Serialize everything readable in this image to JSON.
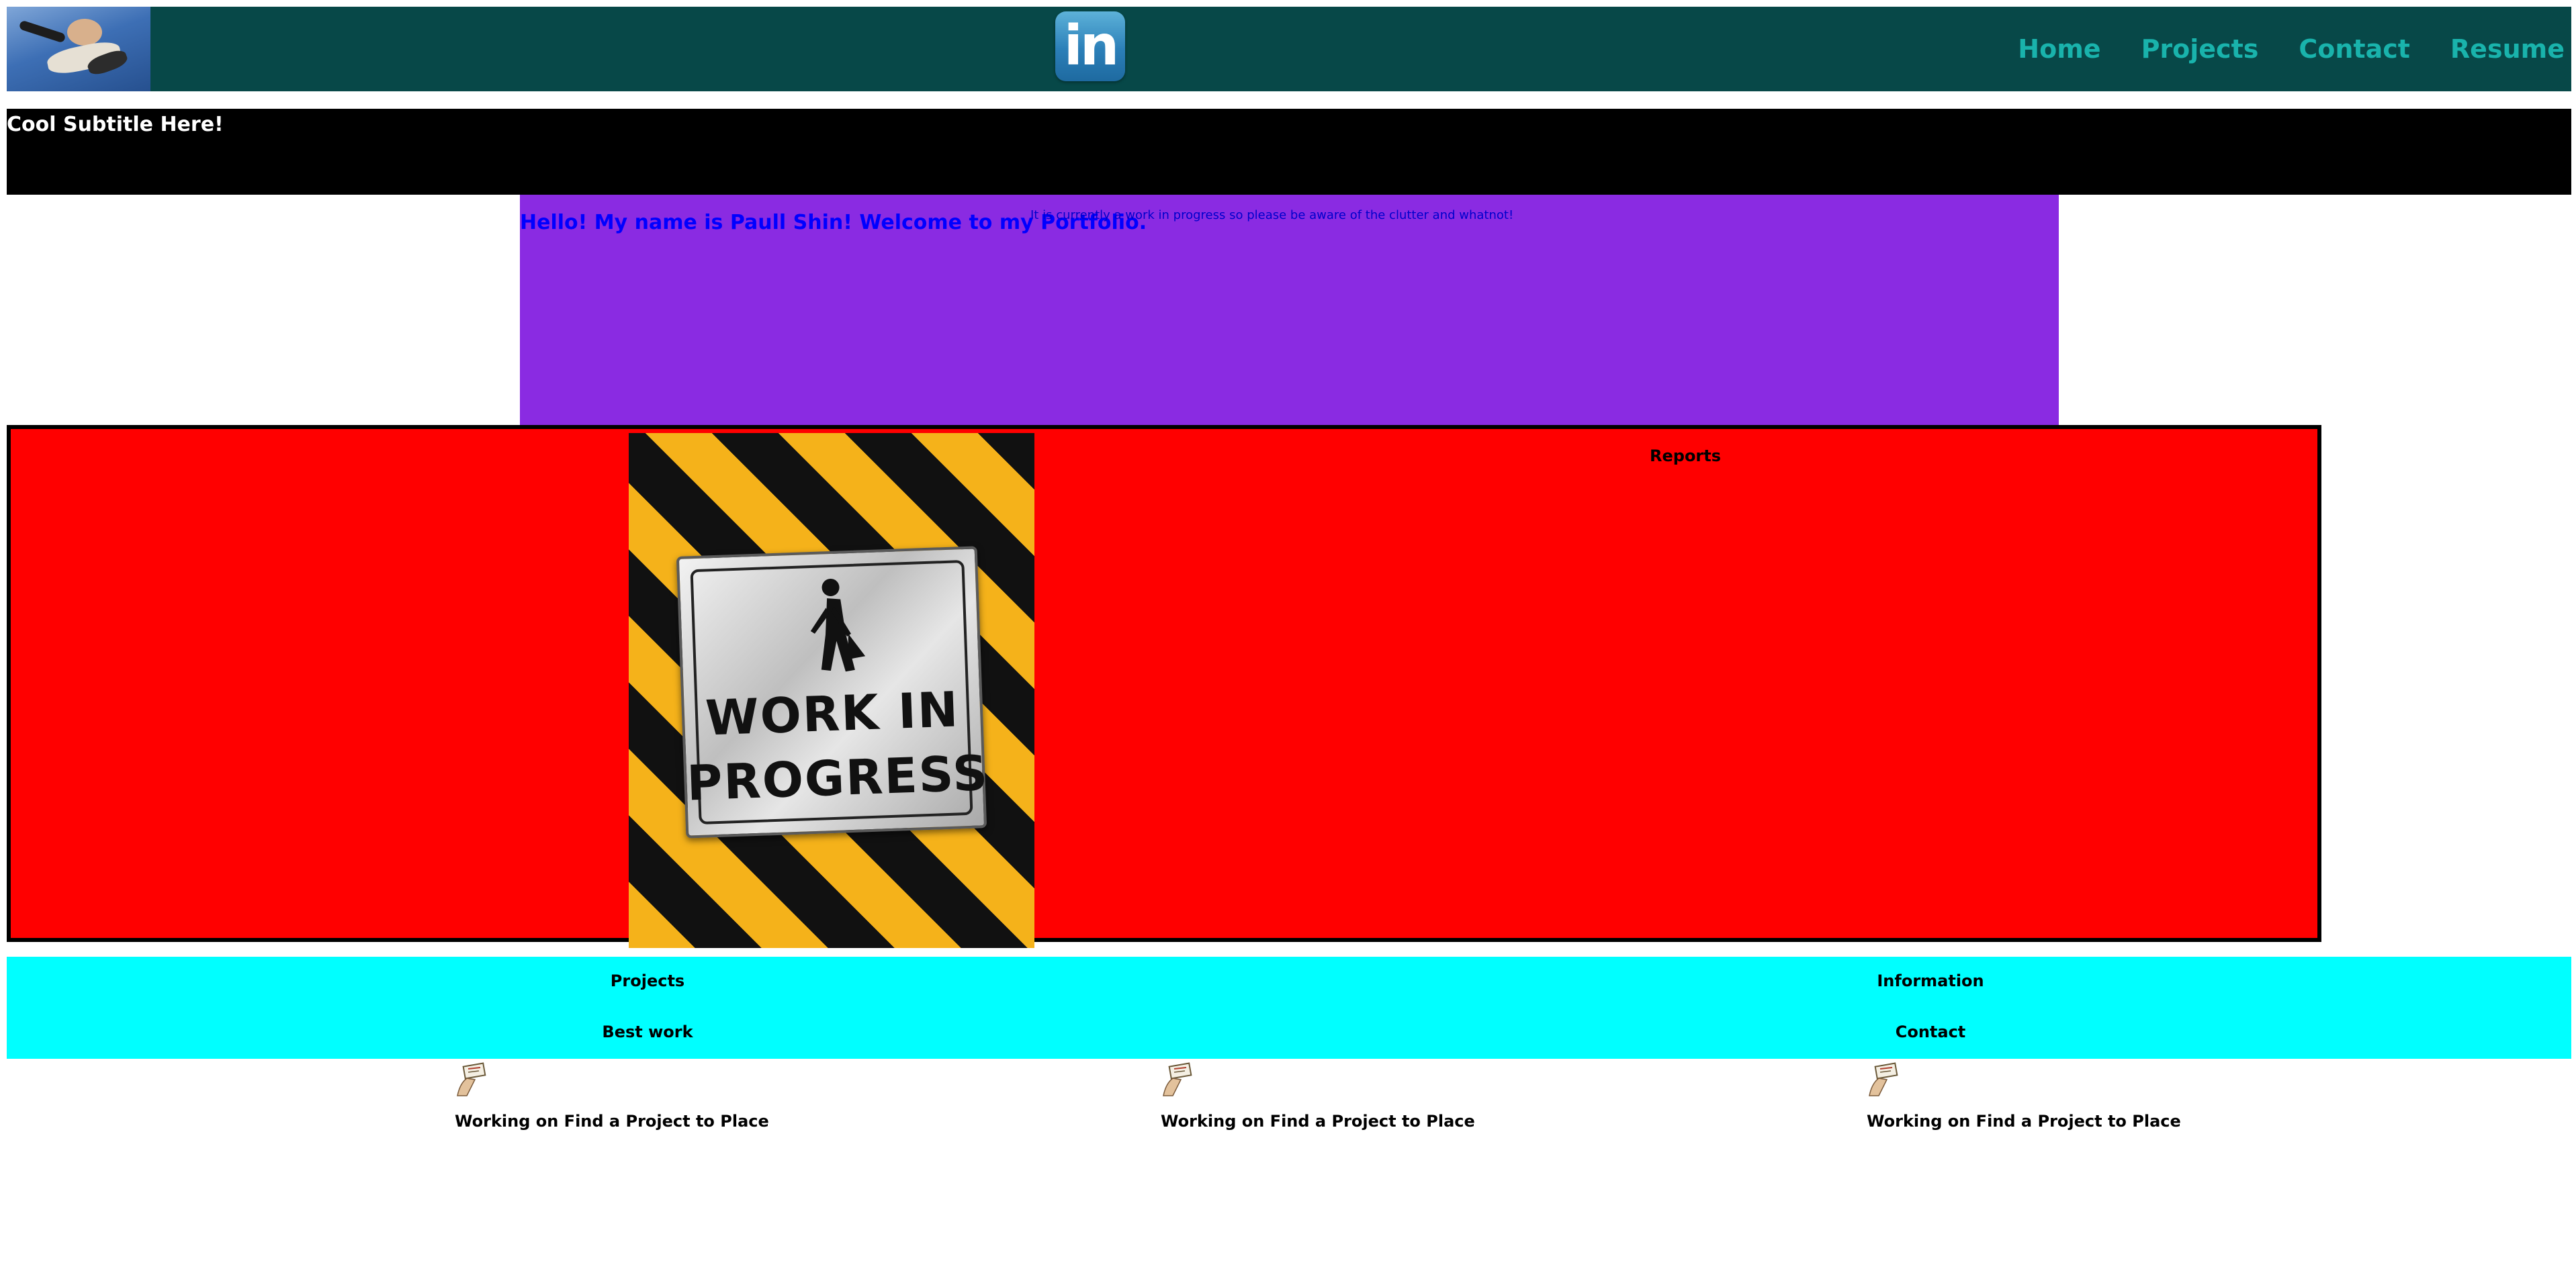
{
  "header": {
    "avatar_alt": "profile photo",
    "linkedin_text": "in",
    "nav": [
      "Home",
      "Projects",
      "Contact",
      "Resume"
    ]
  },
  "subtitle": "Cool Subtitle Here!",
  "intro": {
    "greeting": "Hello! My name is Paull Shin! Welcome to my Portfolio.",
    "notice": "It is currently a work in progress so please be aware of the clutter and whatnot!"
  },
  "reports": {
    "label": "Reports",
    "image": {
      "icon": "work-in-progress-sign",
      "line1": "WORK IN",
      "line2": "PROGRESS"
    }
  },
  "info_band": {
    "projects": "Projects",
    "best_work": "Best work",
    "information": "Information",
    "contact": "Contact"
  },
  "cards": [
    {
      "caption": "Working on Find a Project to Place"
    },
    {
      "caption": "Working on Find a Project to Place"
    },
    {
      "caption": "Working on Find a Project to Place"
    }
  ],
  "colors": {
    "header_bg": "#074848",
    "nav_text": "#19b3ac",
    "subtitle_bg": "#000000",
    "intro_bg": "#8a2be2",
    "intro_text": "#0000ff",
    "reports_bg": "#ff0000",
    "info_bg": "#00ffff"
  }
}
